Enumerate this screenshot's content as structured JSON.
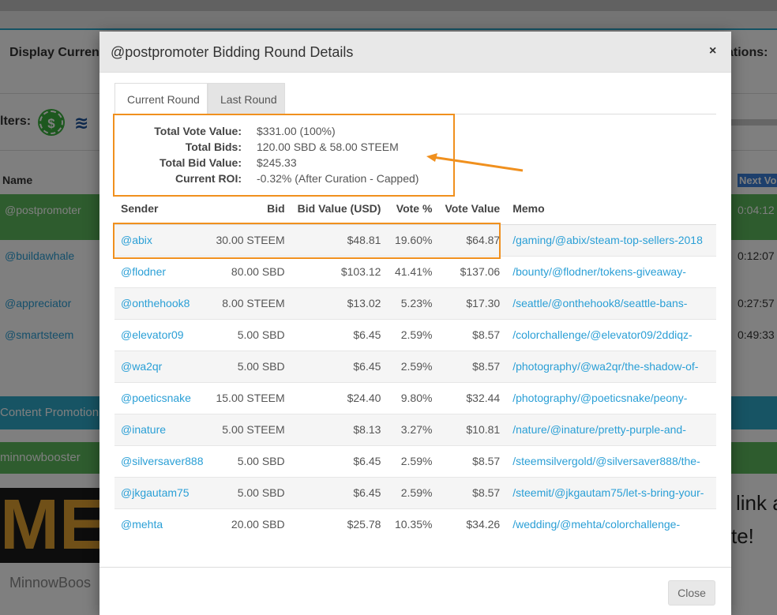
{
  "background": {
    "display_label": "Display Curreno",
    "notifications_label": "ations:",
    "filters_label": "lters:",
    "dollar_icon": "$",
    "name_header": "Name",
    "next_vote_header": "Next Vo",
    "rows": [
      {
        "account": "@postpromoter",
        "time": "0:04:12"
      },
      {
        "account": "@buildawhale",
        "time": "0:12:07"
      },
      {
        "account": "@appreciator",
        "time": "0:27:57"
      },
      {
        "account": "@smartsteem",
        "time": "0:49:33"
      }
    ],
    "banner_content_promotion": "Content Promotion",
    "banner_minnowbooster": "minnowbooster",
    "logo_letters": "ME",
    "logo_caption": "MinnowBoos",
    "text_link": "link a",
    "text_te": "te!"
  },
  "modal": {
    "title": "@postpromoter Bidding Round Details",
    "close_x": "×",
    "tabs": [
      {
        "label": "Current Round"
      },
      {
        "label": "Last Round"
      }
    ],
    "summary": {
      "total_vote_value_label": "Total Vote Value:",
      "total_vote_value": "$331.00 (100%)",
      "total_bids_label": "Total Bids:",
      "total_bids": "120.00 SBD & 58.00 STEEM",
      "total_bid_value_label": "Total Bid Value:",
      "total_bid_value": "$245.33",
      "current_roi_label": "Current ROI:",
      "current_roi": "-0.32% (After Curation - Capped)"
    },
    "columns": [
      "Sender",
      "Bid",
      "Bid Value (USD)",
      "Vote %",
      "Vote Value",
      "Memo"
    ],
    "rows": [
      [
        "@abix",
        "30.00 STEEM",
        "$48.81",
        "19.60%",
        "$64.87",
        "/gaming/@abix/steam-top-sellers-2018"
      ],
      [
        "@flodner",
        "80.00 SBD",
        "$103.12",
        "41.41%",
        "$137.06",
        "/bounty/@flodner/tokens-giveaway-"
      ],
      [
        "@onthehook8",
        "8.00 STEEM",
        "$13.02",
        "5.23%",
        "$17.30",
        "/seattle/@onthehook8/seattle-bans-"
      ],
      [
        "@elevator09",
        "5.00 SBD",
        "$6.45",
        "2.59%",
        "$8.57",
        "/colorchallenge/@elevator09/2ddiqz-"
      ],
      [
        "@wa2qr",
        "5.00 SBD",
        "$6.45",
        "2.59%",
        "$8.57",
        "/photography/@wa2qr/the-shadow-of-"
      ],
      [
        "@poeticsnake",
        "15.00 STEEM",
        "$24.40",
        "9.80%",
        "$32.44",
        "/photography/@poeticsnake/peony-"
      ],
      [
        "@inature",
        "5.00 STEEM",
        "$8.13",
        "3.27%",
        "$10.81",
        "/nature/@inature/pretty-purple-and-"
      ],
      [
        "@silversaver888",
        "5.00 SBD",
        "$6.45",
        "2.59%",
        "$8.57",
        "/steemsilvergold/@silversaver888/the-"
      ],
      [
        "@jkgautam75",
        "5.00 SBD",
        "$6.45",
        "2.59%",
        "$8.57",
        "/steemit/@jkgautam75/let-s-bring-your-"
      ],
      [
        "@mehta",
        "20.00 SBD",
        "$25.78",
        "10.35%",
        "$34.26",
        "/wedding/@mehta/colorchallenge-"
      ]
    ],
    "close_button": "Close"
  },
  "colors": {
    "accent_link": "#2a9fd6",
    "highlight_orange": "#f0901e",
    "green": "#5cb85c",
    "teal": "#2fa9c9"
  }
}
